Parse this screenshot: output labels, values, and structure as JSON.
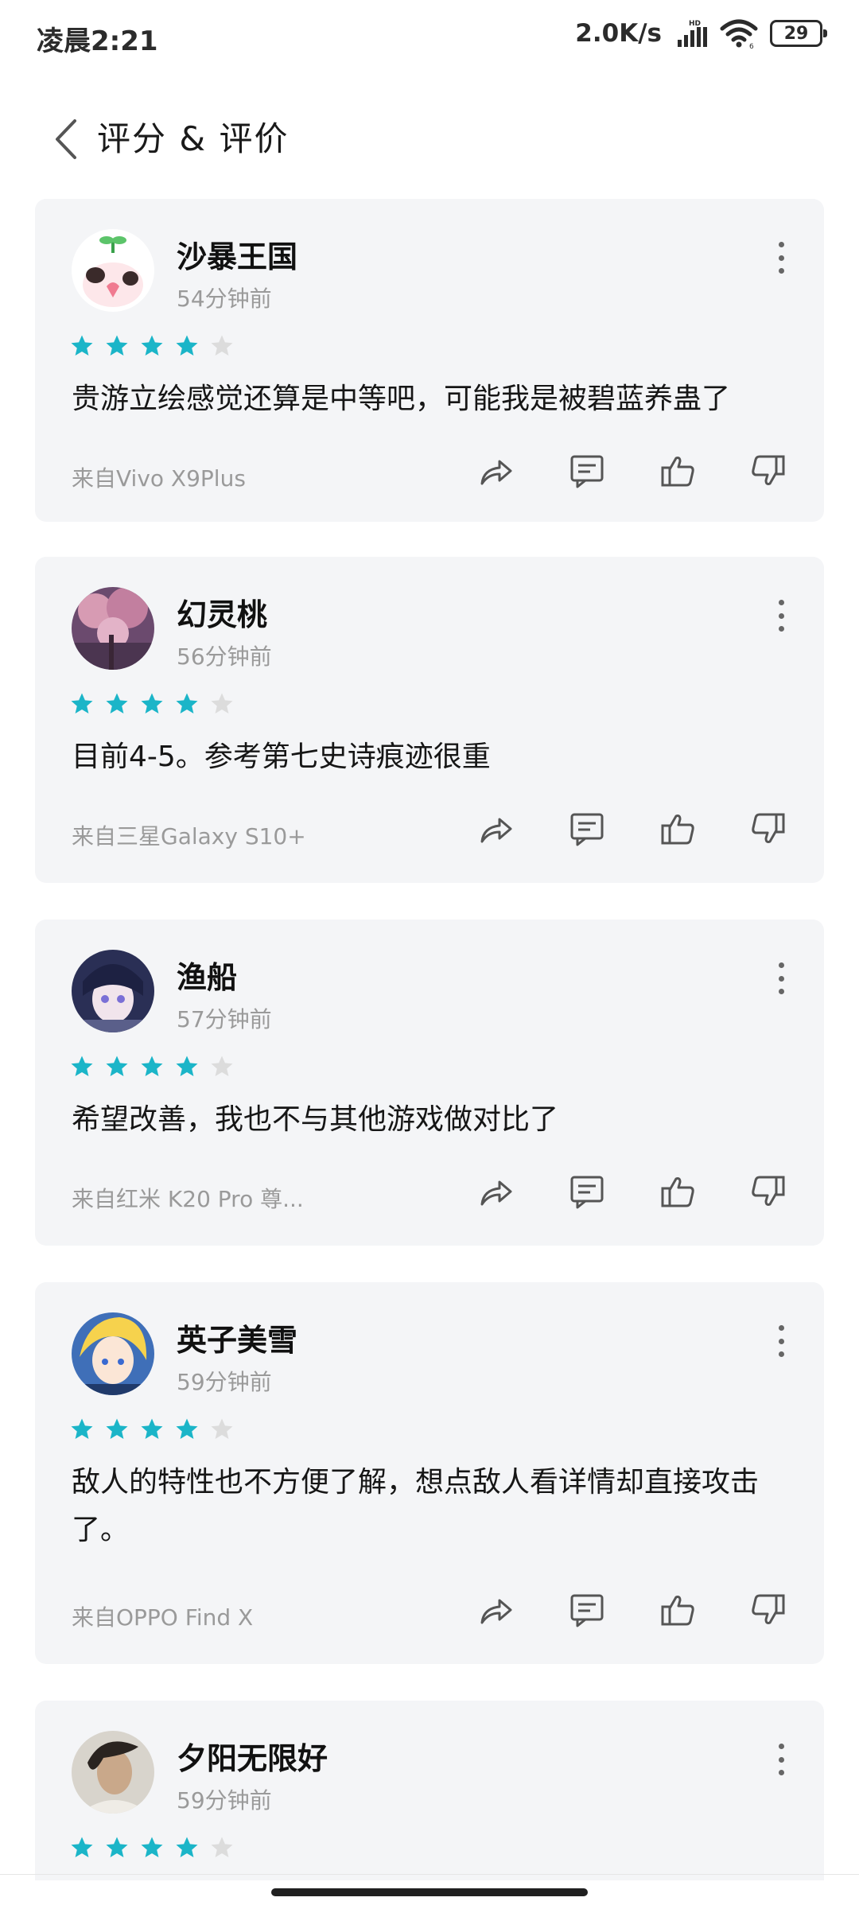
{
  "status_bar": {
    "time": "凌晨2:21",
    "network_speed": "2.0K/s",
    "battery_level": "29",
    "signal_icon": "signal-hd-icon",
    "wifi_icon": "wifi-icon"
  },
  "header": {
    "back_icon": "chevron-left-icon",
    "title": "评分 & 评价"
  },
  "colors": {
    "star_filled": "#1bb5c8",
    "star_empty": "#dcdcdc",
    "card_background": "#f4f5f7",
    "muted_text": "#9a9a9a"
  },
  "reviews": [
    {
      "user_name": "沙暴王国",
      "time_ago": "54分钟前",
      "rating": 4,
      "max_rating": 5,
      "text": "贵游立绘感觉还算是中等吧，可能我是被碧蓝养蛊了",
      "device": "来自Vivo X9Plus"
    },
    {
      "user_name": "幻灵桃",
      "time_ago": "56分钟前",
      "rating": 4,
      "max_rating": 5,
      "text": "目前4-5。参考第七史诗痕迹很重",
      "device": "来自三星Galaxy S10+"
    },
    {
      "user_name": "渔船",
      "time_ago": "57分钟前",
      "rating": 4,
      "max_rating": 5,
      "text": "希望改善，我也不与其他游戏做对比了",
      "device": "来自红米 K20 Pro 尊..."
    },
    {
      "user_name": "英子美雪",
      "time_ago": "59分钟前",
      "rating": 4,
      "max_rating": 5,
      "text": "敌人的特性也不方便了解，想点敌人看详情却直接攻击了。",
      "device": "来自OPPO Find X"
    },
    {
      "user_name": "夕阳无限好",
      "time_ago": "59分钟前",
      "rating": 4,
      "max_rating": 5,
      "text": "",
      "device": ""
    }
  ],
  "action_icons": [
    "share-icon",
    "comment-icon",
    "thumbs-up-icon",
    "thumbs-down-icon"
  ]
}
